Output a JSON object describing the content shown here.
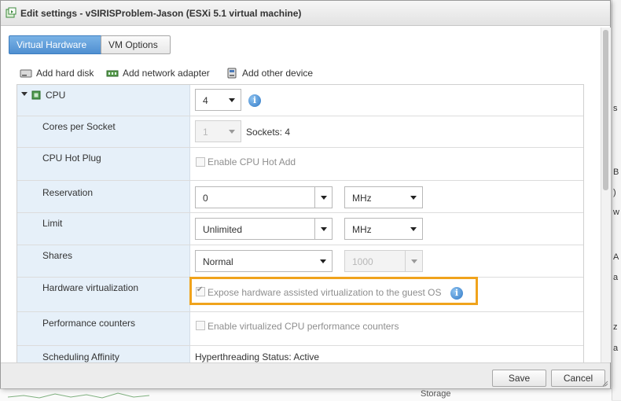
{
  "window": {
    "title": "Edit settings - vSIRISProblem-Jason (ESXi 5.1 virtual machine)"
  },
  "tabs": [
    {
      "label": "Virtual Hardware",
      "active": true
    },
    {
      "label": "VM Options",
      "active": false
    }
  ],
  "toolbar": {
    "add_hard_disk": "Add hard disk",
    "add_network_adapter": "Add network adapter",
    "add_other_device": "Add other device"
  },
  "rows": {
    "cpu": {
      "label": "CPU",
      "value": "4"
    },
    "cores_per_socket": {
      "label": "Cores per Socket",
      "value": "1",
      "sockets": "Sockets: 4"
    },
    "cpu_hot_plug": {
      "label": "CPU Hot Plug",
      "checkbox_label": "Enable CPU Hot Add",
      "checked": false
    },
    "reservation": {
      "label": "Reservation",
      "value": "0",
      "unit": "MHz"
    },
    "limit": {
      "label": "Limit",
      "value": "Unlimited",
      "unit": "MHz"
    },
    "shares": {
      "label": "Shares",
      "value": "Normal",
      "amount": "1000"
    },
    "hardware_virtualization": {
      "label": "Hardware virtualization",
      "checkbox_label": "Expose hardware assisted virtualization to the guest OS",
      "checked": true
    },
    "performance_counters": {
      "label": "Performance counters",
      "checkbox_label": "Enable virtualized CPU performance counters",
      "checked": false
    },
    "scheduling_affinity": {
      "label": "Scheduling Affinity",
      "value": "Hyperthreading Status: Active"
    }
  },
  "footer": {
    "save": "Save",
    "cancel": "Cancel"
  },
  "background": {
    "storage": "Storage"
  },
  "colors": {
    "accent": "#4f8fd1",
    "highlight": "#f0a31c",
    "label_bg": "#e6f0f9"
  }
}
